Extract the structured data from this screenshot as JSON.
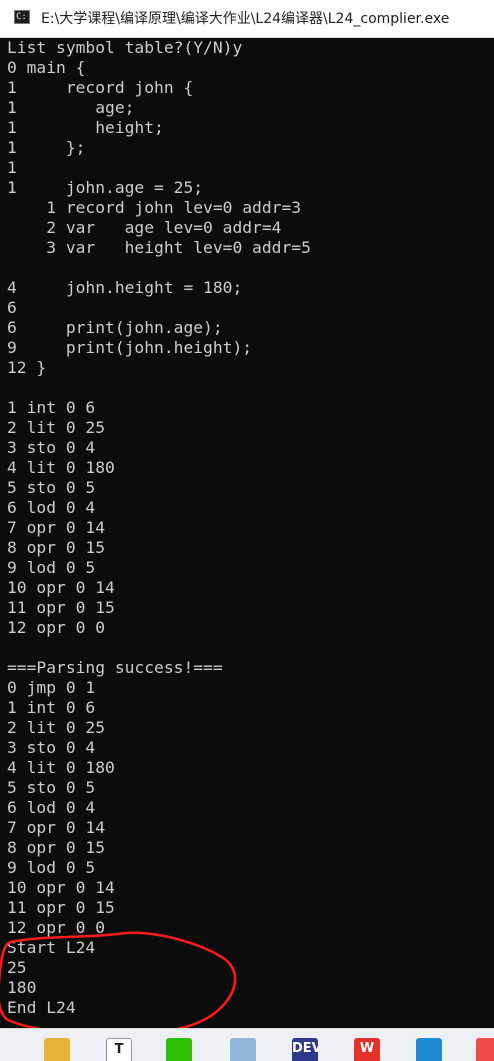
{
  "window": {
    "title": "E:\\大学课程\\编译原理\\编译大作业\\L24编译器\\L24_complier.exe",
    "icon": "console-app-icon"
  },
  "console": {
    "lines": [
      "List symbol table?(Y/N)y",
      "0 main {",
      "1     record john {",
      "1        age;",
      "1        height;",
      "1     };",
      "1",
      "1     john.age = 25;",
      "    1 record john lev=0 addr=3",
      "    2 var   age lev=0 addr=4",
      "    3 var   height lev=0 addr=5",
      "",
      "4     john.height = 180;",
      "6",
      "6     print(john.age);",
      "9     print(john.height);",
      "12 }",
      "",
      "1 int 0 6",
      "2 lit 0 25",
      "3 sto 0 4",
      "4 lit 0 180",
      "5 sto 0 5",
      "6 lod 0 4",
      "7 opr 0 14",
      "8 opr 0 15",
      "9 lod 0 5",
      "10 opr 0 14",
      "11 opr 0 15",
      "12 opr 0 0",
      "",
      "===Parsing success!===",
      "0 jmp 0 1",
      "1 int 0 6",
      "2 lit 0 25",
      "3 sto 0 4",
      "4 lit 0 180",
      "5 sto 0 5",
      "6 lod 0 4",
      "7 opr 0 14",
      "8 opr 0 15",
      "9 lod 0 5",
      "10 opr 0 14",
      "11 opr 0 15",
      "12 opr 0 0",
      "Start L24",
      "25",
      "180",
      "End L24"
    ]
  },
  "taskbar": {
    "apps": [
      {
        "name": "file-explorer-icon",
        "label": "",
        "color": "#e8b33b"
      },
      {
        "name": "typora-icon",
        "label": "T",
        "color": "#ffffff"
      },
      {
        "name": "wechat-icon",
        "label": "",
        "color": "#2dc100"
      },
      {
        "name": "notepad-icon",
        "label": "",
        "color": "#8fb7d9"
      },
      {
        "name": "dev-cpp-icon",
        "label": "DEV",
        "color": "#2d3a8c"
      },
      {
        "name": "wps-icon",
        "label": "W",
        "color": "#e4322b"
      },
      {
        "name": "vscode-icon",
        "label": "",
        "color": "#1f8ad2"
      },
      {
        "name": "app-red-icon",
        "label": "",
        "color": "#ef4a4a"
      }
    ]
  },
  "colors": {
    "console_bg": "#0c0c0c",
    "console_text": "#cccccc",
    "annotation": "#ff1a1a"
  }
}
